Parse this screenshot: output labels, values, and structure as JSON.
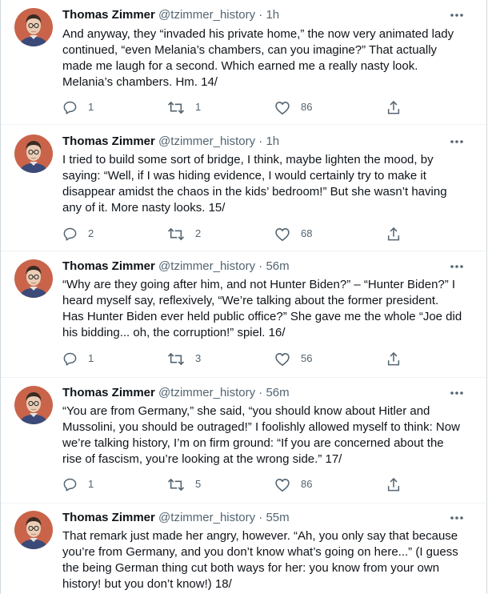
{
  "colors": {
    "text": "#0f1419",
    "secondary": "#536471",
    "divider": "#eff3f4",
    "avatar_bg": "#c9644a"
  },
  "tweets": [
    {
      "name": "Thomas Zimmer",
      "handle": "@tzimmer_history",
      "time": "· 1h",
      "text": "And anyway, they “invaded his private home,” the now very animated lady continued, “even Melania’s chambers, can you imagine?” That actually made me laugh for a second. Which earned me a really nasty look. Melania’s chambers. Hm. 14/",
      "replies": "1",
      "retweets": "1",
      "likes": "86"
    },
    {
      "name": "Thomas Zimmer",
      "handle": "@tzimmer_history",
      "time": "· 1h",
      "text": "I tried to build some sort of bridge, I think, maybe lighten the mood, by saying: “Well, if I was hiding evidence, I would certainly try to make it disappear amidst the chaos in the kids’ bedroom!” But she wasn’t having any of it. More nasty looks. 15/",
      "replies": "2",
      "retweets": "2",
      "likes": "68"
    },
    {
      "name": "Thomas Zimmer",
      "handle": "@tzimmer_history",
      "time": "· 56m",
      "text": "“Why are they going after him, and not Hunter Biden?” – “Hunter Biden?” I heard myself say, reflexively, “We’re talking about the former president. Has Hunter Biden ever held public office?” She gave me the whole “Joe did his bidding... oh, the corruption!” spiel. 16/",
      "replies": "1",
      "retweets": "3",
      "likes": "56"
    },
    {
      "name": "Thomas Zimmer",
      "handle": "@tzimmer_history",
      "time": "· 56m",
      "text": "“You are from Germany,” she said, “you should know about Hitler and Mussolini, you should be outraged!” I foolishly allowed myself to think: Now we’re talking history, I’m on firm ground: “If you are concerned about the rise of fascism, you’re looking at the wrong side.” 17/",
      "replies": "1",
      "retweets": "5",
      "likes": "86"
    },
    {
      "name": "Thomas Zimmer",
      "handle": "@tzimmer_history",
      "time": "· 55m",
      "text": "That remark just made her angry, however. “Ah, you only say that because you’re from Germany, and you don’t know what’s going on here...” (I guess the being German thing cut both ways for her: you know from your own history! but you don’t know!) 18/"
    }
  ]
}
